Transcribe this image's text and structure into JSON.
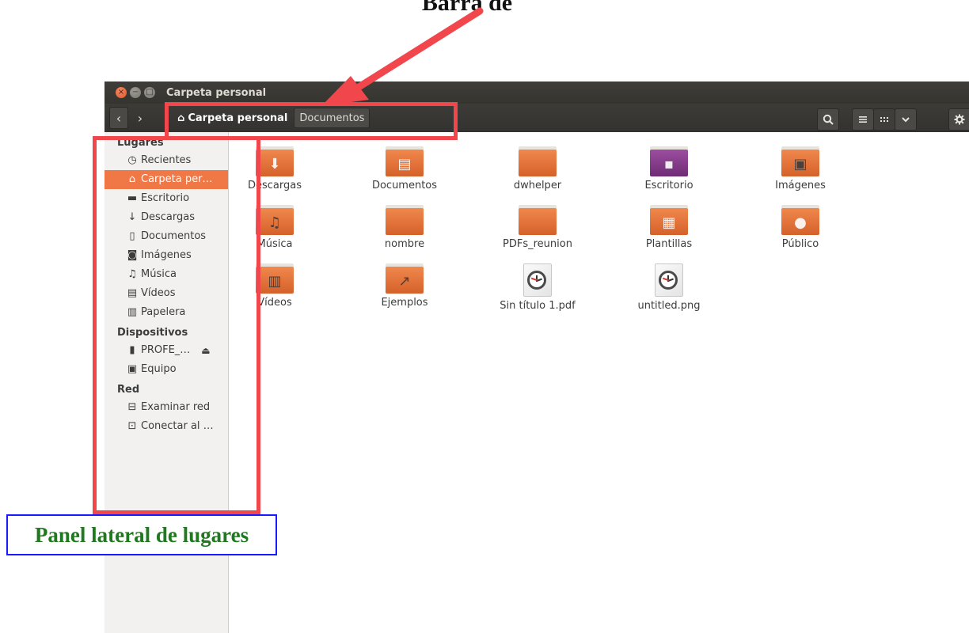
{
  "annotations": {
    "top_label": "Barra de navegación",
    "panel_label": "Panel lateral de lugares",
    "highlight_color": "#f2464d",
    "label_border_color": "#1a1aff",
    "label_text_color": "#1f7a1f"
  },
  "window": {
    "title": "Carpeta personal",
    "controls": {
      "close": "×",
      "minimize": "−",
      "maximize": "□"
    }
  },
  "toolbar": {
    "back": "‹",
    "forward": "›",
    "path": [
      {
        "label": "Carpeta personal",
        "icon": "home-icon"
      },
      {
        "label": "Documentos"
      }
    ],
    "buttons": {
      "search": "search-icon",
      "list_view": "list-icon",
      "grid_view": "grid-icon",
      "view_options": "chevron-down-icon",
      "settings": "gear-icon"
    }
  },
  "sidebar": {
    "sections": [
      {
        "title": "Lugares",
        "items": [
          {
            "label": "Recientes",
            "icon": "clock-icon"
          },
          {
            "label": "Carpeta per…",
            "icon": "home-icon",
            "active": true
          },
          {
            "label": "Escritorio",
            "icon": "desktop-folder-icon"
          },
          {
            "label": "Descargas",
            "icon": "download-icon"
          },
          {
            "label": "Documentos",
            "icon": "document-icon"
          },
          {
            "label": "Imágenes",
            "icon": "camera-icon"
          },
          {
            "label": "Música",
            "icon": "music-icon"
          },
          {
            "label": "Vídeos",
            "icon": "film-icon"
          },
          {
            "label": "Papelera",
            "icon": "trash-icon"
          }
        ]
      },
      {
        "title": "Dispositivos",
        "items": [
          {
            "label": "PROFE_…",
            "icon": "usb-icon",
            "eject": true
          },
          {
            "label": "Equipo",
            "icon": "computer-icon"
          }
        ]
      },
      {
        "title": "Red",
        "items": [
          {
            "label": "Examinar red",
            "icon": "network-icon"
          },
          {
            "label": "Conectar al …",
            "icon": "server-icon"
          }
        ]
      }
    ]
  },
  "files": [
    {
      "name": "Descargas",
      "type": "folder",
      "emblem": "download-arrow"
    },
    {
      "name": "Documentos",
      "type": "folder",
      "emblem": "document"
    },
    {
      "name": "dwhelper",
      "type": "folder",
      "emblem": ""
    },
    {
      "name": "Escritorio",
      "type": "folder",
      "emblem": "desktop"
    },
    {
      "name": "Imágenes",
      "type": "folder",
      "emblem": "photo"
    },
    {
      "name": "Música",
      "type": "folder",
      "emblem": "music-note"
    },
    {
      "name": "nombre",
      "type": "folder",
      "emblem": ""
    },
    {
      "name": "PDFs_reunion",
      "type": "folder",
      "emblem": ""
    },
    {
      "name": "Plantillas",
      "type": "folder",
      "emblem": "template"
    },
    {
      "name": "Público",
      "type": "folder",
      "emblem": "person"
    },
    {
      "name": "Vídeos",
      "type": "folder",
      "emblem": "film"
    },
    {
      "name": "Ejemplos",
      "type": "folder",
      "emblem": "link-arrow"
    },
    {
      "name": "Sin título 1.pdf",
      "type": "file",
      "emblem": "clock"
    },
    {
      "name": "untitled.png",
      "type": "file",
      "emblem": "clock"
    }
  ]
}
